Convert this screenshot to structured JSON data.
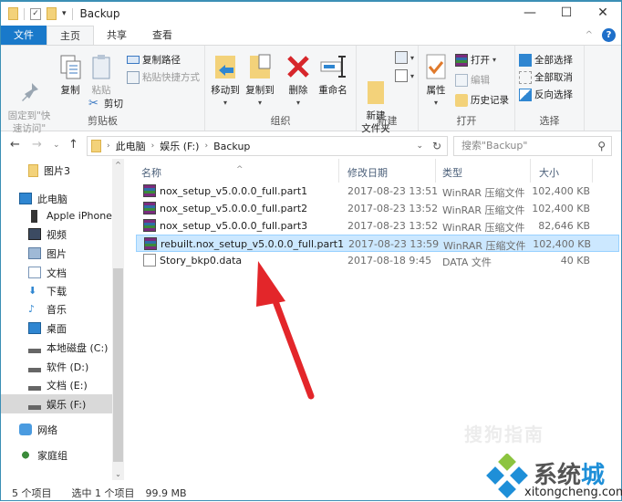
{
  "window": {
    "title": "Backup",
    "controls": [
      "minimize",
      "maximize",
      "close"
    ]
  },
  "ribbon_tabs": [
    "文件",
    "主页",
    "共享",
    "查看"
  ],
  "ribbon": {
    "clipboard": {
      "label": "剪贴板",
      "pin": "固定到\"快\n速访问\"",
      "copy": "复制",
      "paste": "粘贴",
      "copy_path": "复制路径",
      "paste_shortcut": "粘贴快捷方式",
      "cut": "剪切"
    },
    "organize": {
      "label": "组织",
      "move_to": "移动到",
      "copy_to": "复制到",
      "delete": "删除",
      "rename": "重命名"
    },
    "new": {
      "label": "新建",
      "new_folder": "新建\n文件夹"
    },
    "open": {
      "label": "打开",
      "properties": "属性",
      "open": "打开",
      "edit": "编辑",
      "history": "历史记录"
    },
    "select": {
      "label": "选择",
      "select_all": "全部选择",
      "select_none": "全部取消",
      "invert": "反向选择"
    }
  },
  "address": {
    "breadcrumb": [
      "此电脑",
      "娱乐 (F:)",
      "Backup"
    ],
    "search_placeholder": "搜索\"Backup\""
  },
  "nav_pane": [
    {
      "label": "图片3",
      "icon": "folder-icon",
      "indent": 2
    },
    {
      "label": "此电脑",
      "icon": "computer-icon",
      "indent": 1
    },
    {
      "label": "Apple iPhone",
      "icon": "phone-icon",
      "indent": 2
    },
    {
      "label": "视频",
      "icon": "video-icon",
      "indent": 2
    },
    {
      "label": "图片",
      "icon": "pictures-icon",
      "indent": 2
    },
    {
      "label": "文档",
      "icon": "documents-icon",
      "indent": 2
    },
    {
      "label": "下载",
      "icon": "download-icon",
      "indent": 2
    },
    {
      "label": "音乐",
      "icon": "music-icon",
      "indent": 2
    },
    {
      "label": "桌面",
      "icon": "desktop-icon",
      "indent": 2
    },
    {
      "label": "本地磁盘 (C:)",
      "icon": "drive-icon",
      "indent": 2
    },
    {
      "label": "软件 (D:)",
      "icon": "drive-icon",
      "indent": 2
    },
    {
      "label": "文档 (E:)",
      "icon": "drive-icon",
      "indent": 2
    },
    {
      "label": "娱乐 (F:)",
      "icon": "drive-icon",
      "indent": 2,
      "selected": true
    },
    {
      "label": "网络",
      "icon": "network-icon",
      "indent": 1
    },
    {
      "label": "家庭组",
      "icon": "homegroup-icon",
      "indent": 1
    }
  ],
  "columns": {
    "name": "名称",
    "date": "修改日期",
    "type": "类型",
    "size": "大小"
  },
  "files": [
    {
      "name": "nox_setup_v5.0.0.0_full.part1",
      "date": "2017-08-23 13:51",
      "type": "WinRAR 压缩文件",
      "size": "102,400 KB",
      "icon": "rar"
    },
    {
      "name": "nox_setup_v5.0.0.0_full.part2",
      "date": "2017-08-23 13:52",
      "type": "WinRAR 压缩文件",
      "size": "102,400 KB",
      "icon": "rar"
    },
    {
      "name": "nox_setup_v5.0.0.0_full.part3",
      "date": "2017-08-23 13:52",
      "type": "WinRAR 压缩文件",
      "size": "82,646 KB",
      "icon": "rar"
    },
    {
      "name": "rebuilt.nox_setup_v5.0.0.0_full.part1",
      "date": "2017-08-23 13:59",
      "type": "WinRAR 压缩文件",
      "size": "102,400 KB",
      "icon": "rar",
      "selected": true
    },
    {
      "name": "Story_bkp0.data",
      "date": "2017-08-18 9:45",
      "type": "DATA 文件",
      "size": "40 KB",
      "icon": "doc"
    }
  ],
  "status": {
    "count": "5 个项目",
    "selected": "选中 1 个项目",
    "size": "99.9 MB"
  },
  "watermarks": {
    "sogou": "搜狗指南",
    "brand_a": "系统",
    "brand_b": "城",
    "url": "xitongcheng.com"
  },
  "colors": {
    "accent": "#1979ca",
    "selection": "#cce8ff",
    "arrow": "#e3262a"
  }
}
